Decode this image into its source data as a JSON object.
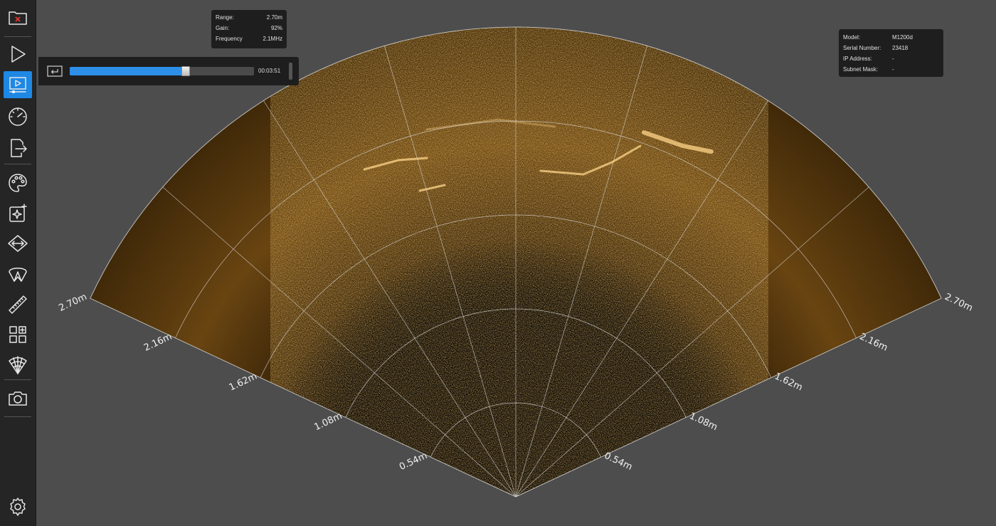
{
  "toolbar": {
    "items": [
      {
        "name": "open-folder-icon"
      },
      {
        "name": "play-icon"
      },
      {
        "name": "playback-icon",
        "active": true
      },
      {
        "name": "gauge-icon"
      },
      {
        "name": "export-icon"
      },
      {
        "name": "palette-icon"
      },
      {
        "name": "enhance-icon"
      },
      {
        "name": "range-icon"
      },
      {
        "name": "aperture-icon"
      },
      {
        "name": "ruler-icon"
      },
      {
        "name": "layout-icon"
      },
      {
        "name": "sonar-fan-icon"
      },
      {
        "name": "camera-icon"
      },
      {
        "name": "settings-icon"
      }
    ]
  },
  "params": {
    "range_label": "Range:",
    "range_value": "2.70m",
    "gain_label": "Gain:",
    "gain_value": "92%",
    "freq_label": "Frequency",
    "freq_value": "2.1MHz"
  },
  "device": {
    "model_label": "Model:",
    "model_value": "M1200d",
    "serial_label": "Serial Number:",
    "serial_value": "23418",
    "ip_label": "IP Address:",
    "ip_value": "-",
    "mask_label": "Subnet Mask:",
    "mask_value": "-"
  },
  "playback": {
    "progress": 0.63,
    "time": "00:03:51"
  },
  "sonar": {
    "max_range": 2.7,
    "half_angle_deg": 65,
    "range_labels": [
      "0.54m",
      "1.08m",
      "1.62m",
      "2.16m",
      "2.70m"
    ],
    "colors": {
      "background": "#4d4d4d",
      "grid": "#d9d9d9",
      "echo": "#e8a53a"
    }
  }
}
